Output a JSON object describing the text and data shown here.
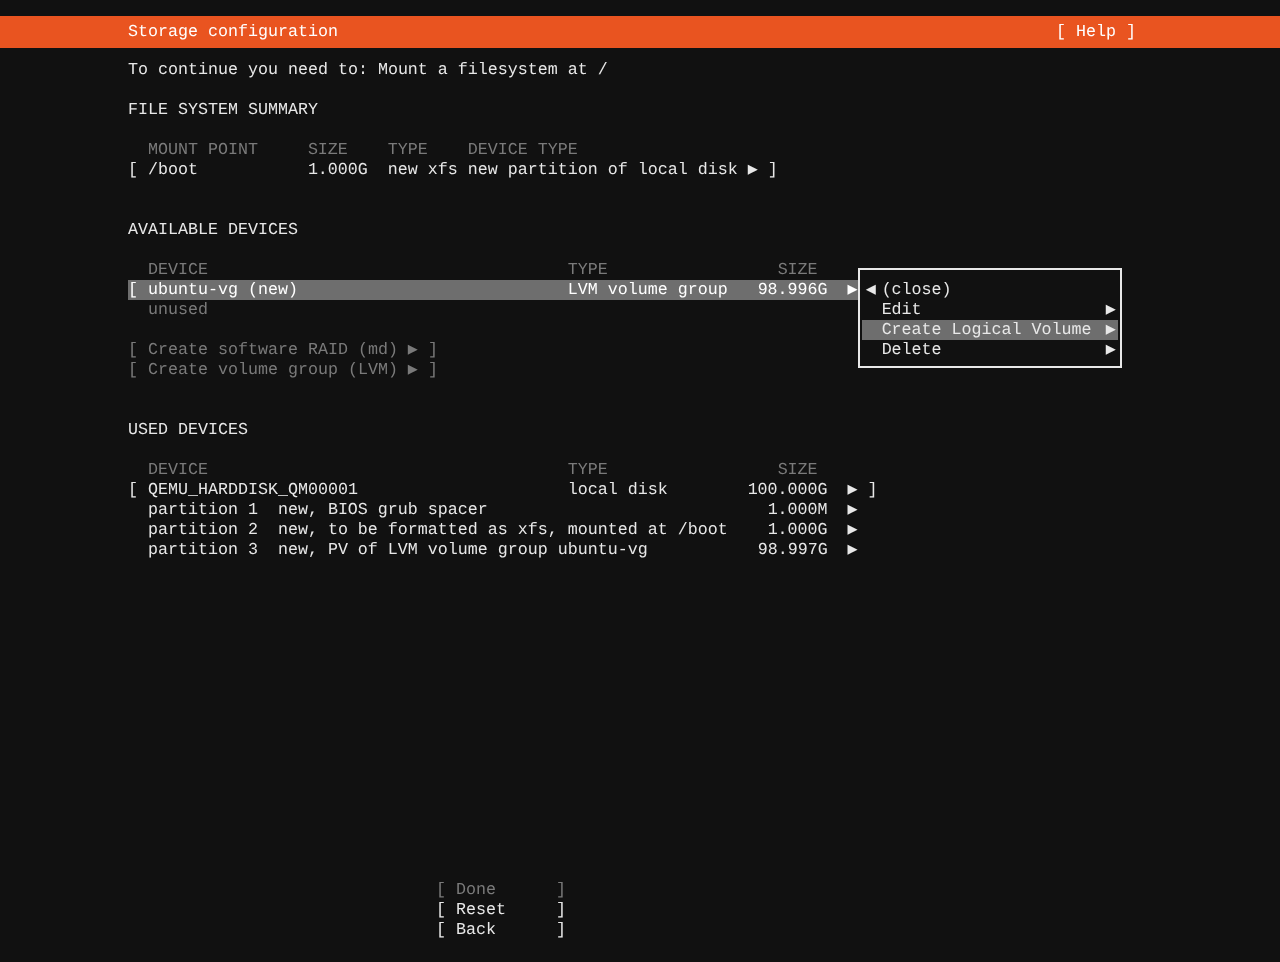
{
  "header": {
    "title": "Storage configuration",
    "help": "[ Help ]"
  },
  "message": "To continue you need to: Mount a filesystem at /",
  "file_system_summary": {
    "heading": "FILE SYSTEM SUMMARY",
    "columns": [
      "MOUNT POINT",
      "SIZE",
      "TYPE",
      "DEVICE TYPE"
    ],
    "rows": [
      {
        "open": "[",
        "mount_point": "/boot",
        "size": "1.000G",
        "type": "new xfs",
        "device_type": "new partition of local disk",
        "arrow": "▶",
        "close": "]"
      }
    ]
  },
  "available_devices": {
    "heading": "AVAILABLE DEVICES",
    "columns": [
      "DEVICE",
      "TYPE",
      "SIZE"
    ],
    "rows": [
      {
        "open": "[",
        "device": "ubuntu-vg (new)",
        "type": "LVM volume group",
        "size": "98.996G",
        "arrow": "▶",
        "selected": true,
        "note": "unused"
      }
    ],
    "actions": [
      {
        "label": "[ Create software RAID (md) ▶ ]",
        "disabled": true
      },
      {
        "label": "[ Create volume group (LVM) ▶ ]",
        "disabled": true
      }
    ]
  },
  "context_menu": {
    "items": [
      {
        "kind": "back",
        "glyph": "◀",
        "label": "(close)",
        "selected": false
      },
      {
        "kind": "submenu",
        "label": "Edit",
        "glyph": "▶",
        "selected": false
      },
      {
        "kind": "submenu",
        "label": "Create Logical Volume",
        "glyph": "▶",
        "selected": true
      },
      {
        "kind": "submenu",
        "label": "Delete",
        "glyph": "▶",
        "selected": false
      }
    ]
  },
  "used_devices": {
    "heading": "USED DEVICES",
    "columns": [
      "DEVICE",
      "TYPE",
      "SIZE"
    ],
    "rows": [
      {
        "kind": "disk",
        "open": "[",
        "device": "QEMU_HARDDISK_QM00001",
        "type": "local disk",
        "size": "100.000G",
        "arrow": "▶",
        "close": "]"
      },
      {
        "kind": "partition",
        "device": "partition 1",
        "description": "new, BIOS grub spacer",
        "size": "1.000M",
        "arrow": "▶"
      },
      {
        "kind": "partition",
        "device": "partition 2",
        "description": "new, to be formatted as xfs, mounted at /boot",
        "size": "1.000G",
        "arrow": "▶"
      },
      {
        "kind": "partition",
        "device": "partition 3",
        "description": "new, PV of LVM volume group ubuntu-vg",
        "size": "98.997G",
        "arrow": "▶"
      }
    ]
  },
  "buttons": [
    {
      "label": "[ Done      ]",
      "disabled": true
    },
    {
      "label": "[ Reset     ]",
      "disabled": false
    },
    {
      "label": "[ Back      ]",
      "disabled": false
    }
  ]
}
